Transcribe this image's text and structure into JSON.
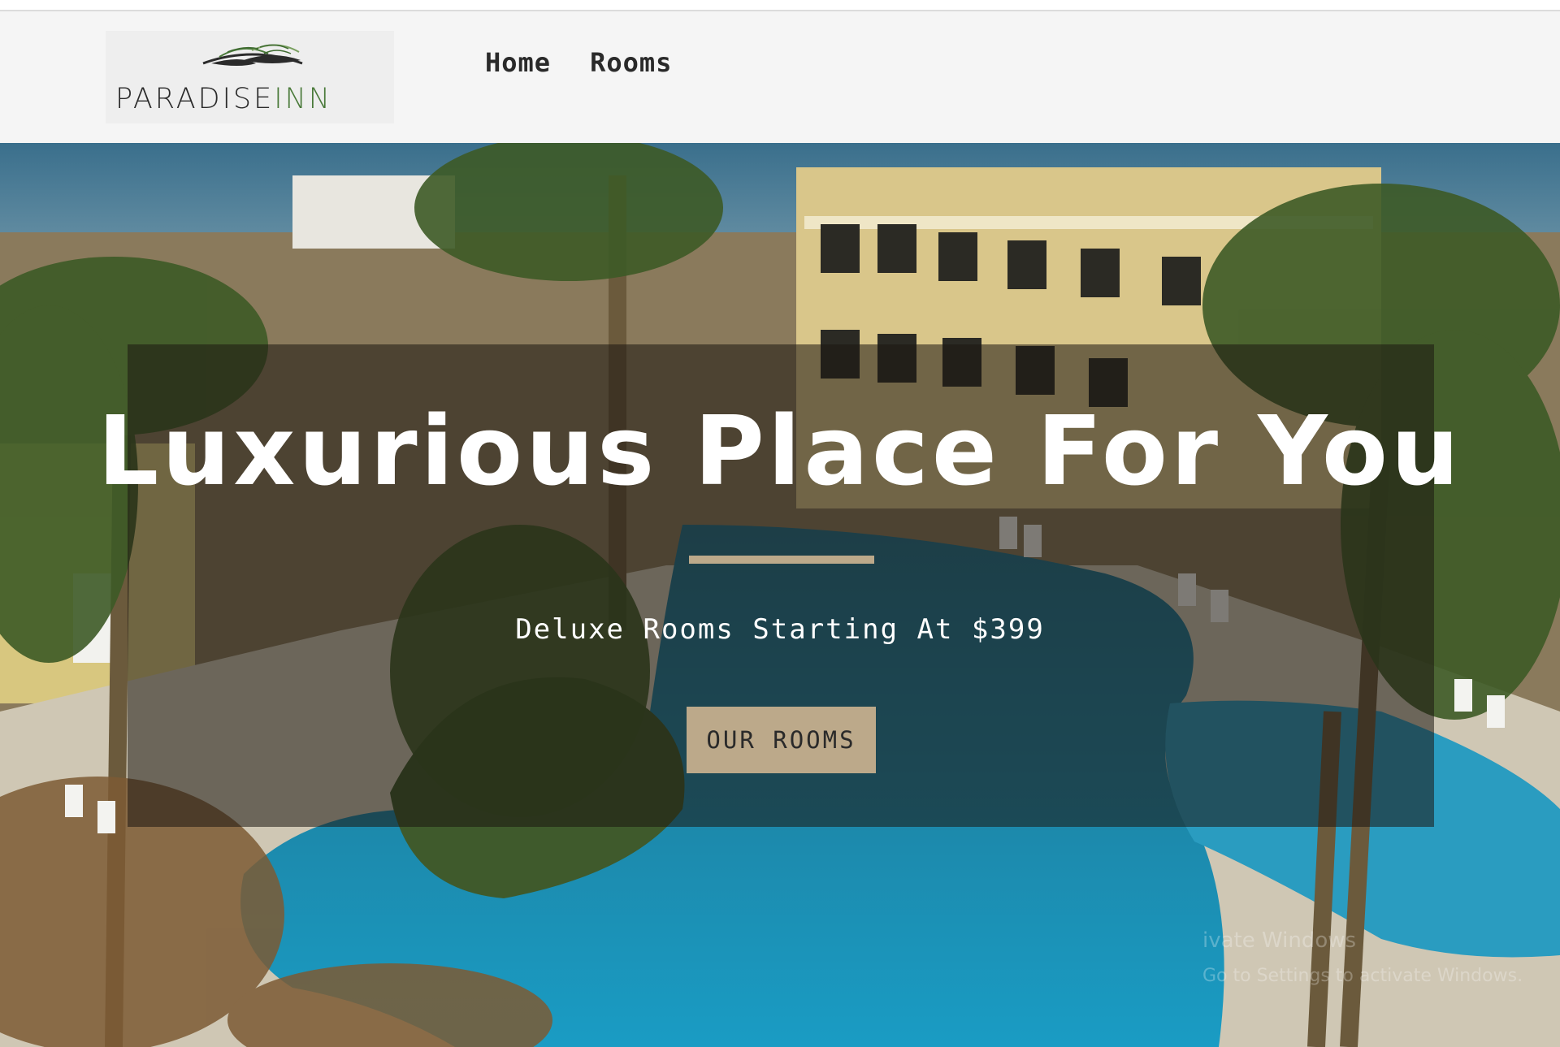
{
  "brand": {
    "name_main": "PARADISE",
    "name_accent": "INN"
  },
  "nav": {
    "items": [
      {
        "label": "Home"
      },
      {
        "label": "Rooms"
      }
    ]
  },
  "hero": {
    "headline": "Luxurious Place For You",
    "subheadline": "Deluxe Rooms Starting At $399",
    "cta_label": "OUR ROOMS"
  },
  "watermark": {
    "line1": "ivate Windows",
    "line2": "Go to Settings to activate Windows."
  },
  "colors": {
    "accent": "#bca98a",
    "nav_bg": "#f5f5f5",
    "overlay": "rgba(28,22,16,0.55)"
  },
  "icons": {
    "logo_mark": "palm-leaf-icon"
  }
}
